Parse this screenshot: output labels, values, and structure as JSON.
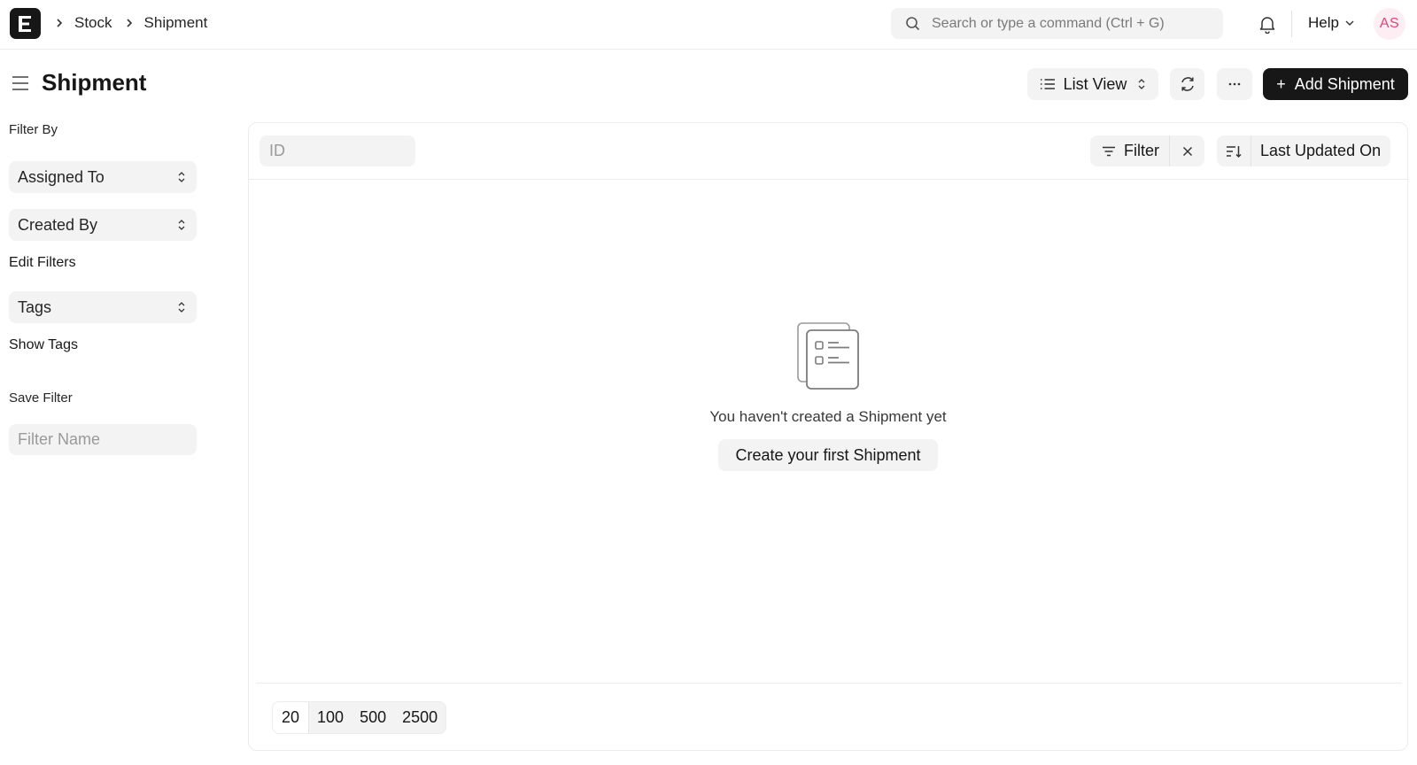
{
  "navbar": {
    "breadcrumbs": [
      "Stock",
      "Shipment"
    ],
    "search_placeholder": "Search or type a command (Ctrl + G)",
    "help_label": "Help",
    "avatar_initials": "AS"
  },
  "page": {
    "title": "Shipment",
    "list_view_label": "List View",
    "add_button_label": "Add Shipment"
  },
  "sidebar": {
    "filter_by_label": "Filter By",
    "assigned_to_label": "Assigned To",
    "created_by_label": "Created By",
    "edit_filters_label": "Edit Filters",
    "tags_label": "Tags",
    "show_tags_label": "Show Tags",
    "save_filter_label": "Save Filter",
    "filter_name_placeholder": "Filter Name"
  },
  "list": {
    "id_placeholder": "ID",
    "filter_label": "Filter",
    "sort_label": "Last Updated On",
    "empty_message": "You haven't created a Shipment yet",
    "create_first_label": "Create your first Shipment",
    "page_sizes": [
      "20",
      "100",
      "500",
      "2500"
    ],
    "selected_page_size": "20"
  },
  "colors": {
    "primary_button": "#171717",
    "avatar_bg": "#fdeef3",
    "avatar_text": "#e0457b",
    "control_bg": "#f3f3f3"
  }
}
